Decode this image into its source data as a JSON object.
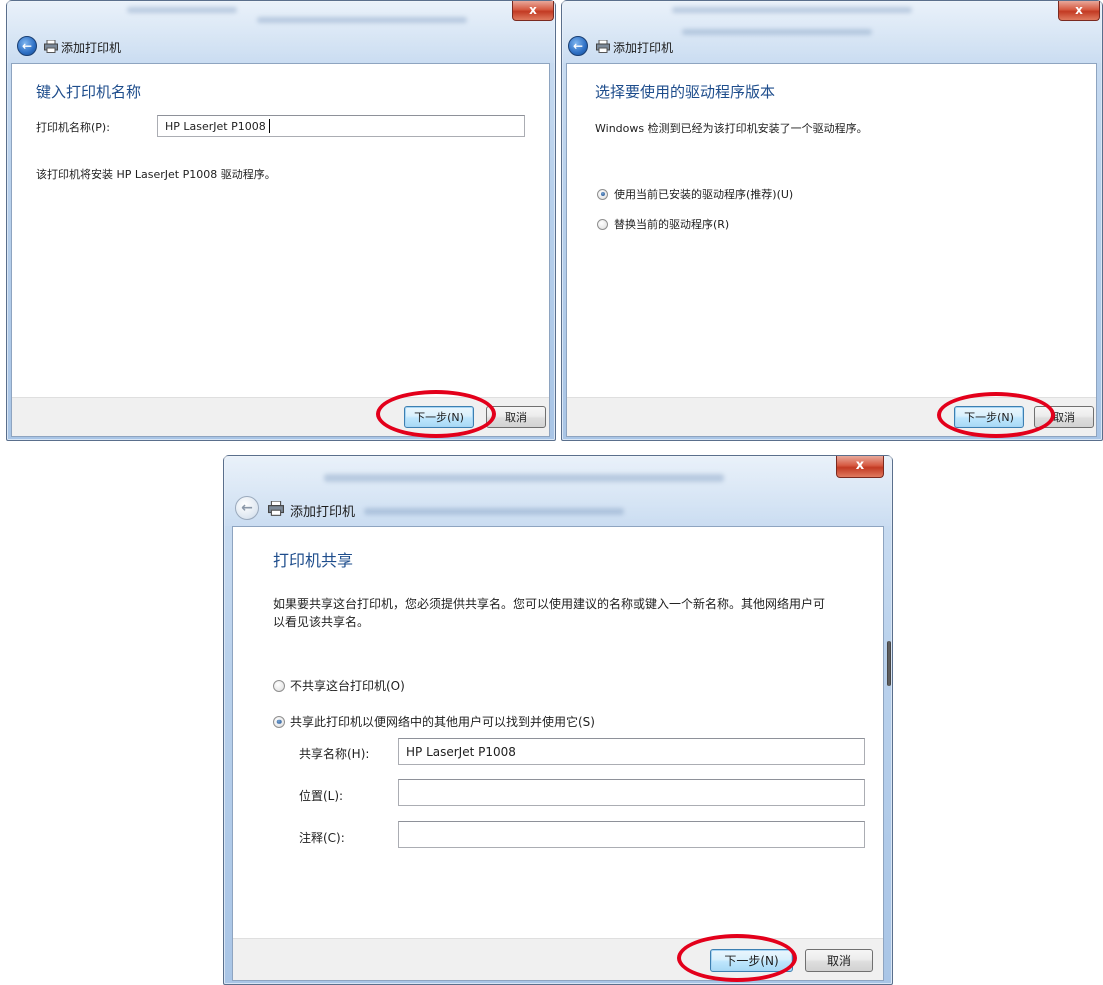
{
  "colors": {
    "heading": "#1e4d8c",
    "highlight_ring": "#e3001b",
    "close_button": "#c23a23",
    "primary_button_border": "#3c7fb1"
  },
  "icons": {
    "back": "back-arrow-icon",
    "printer": "printer-icon",
    "close": "close-icon",
    "radio_selected": "radio-selected-icon",
    "radio_unselected": "radio-unselected-icon"
  },
  "dialog1": {
    "close_glyph": "x",
    "title": "添加打印机",
    "heading": "键入打印机名称",
    "name_label": "打印机名称(P):",
    "name_value": "HP LaserJet P1008",
    "info_text": "该打印机将安装 HP LaserJet P1008 驱动程序。",
    "next_button": "下一步(N)",
    "cancel_button": "取消"
  },
  "dialog2": {
    "close_glyph": "x",
    "title": "添加打印机",
    "heading": "选择要使用的驱动程序版本",
    "info_text": "Windows 检测到已经为该打印机安装了一个驱动程序。",
    "option_use_current": "使用当前已安装的驱动程序(推荐)(U)",
    "option_replace": "替换当前的驱动程序(R)",
    "selected_option": "use_current",
    "next_button": "下一步(N)",
    "cancel_button": "取消"
  },
  "dialog3": {
    "close_glyph": "x",
    "title": "添加打印机",
    "heading": "打印机共享",
    "description_line1": "如果要共享这台打印机，您必须提供共享名。您可以使用建议的名称或键入一个新名称。其他网络用户可",
    "description_line2": "以看见该共享名。",
    "option_no_share": "不共享这台打印机(O)",
    "option_share": "共享此打印机以便网络中的其他用户可以找到并使用它(S)",
    "selected_option": "share",
    "share_name_label": "共享名称(H):",
    "share_name_value": "HP LaserJet P1008",
    "location_label": "位置(L):",
    "location_value": "",
    "comment_label": "注释(C):",
    "comment_value": "",
    "next_button": "下一步(N)",
    "cancel_button": "取消"
  }
}
